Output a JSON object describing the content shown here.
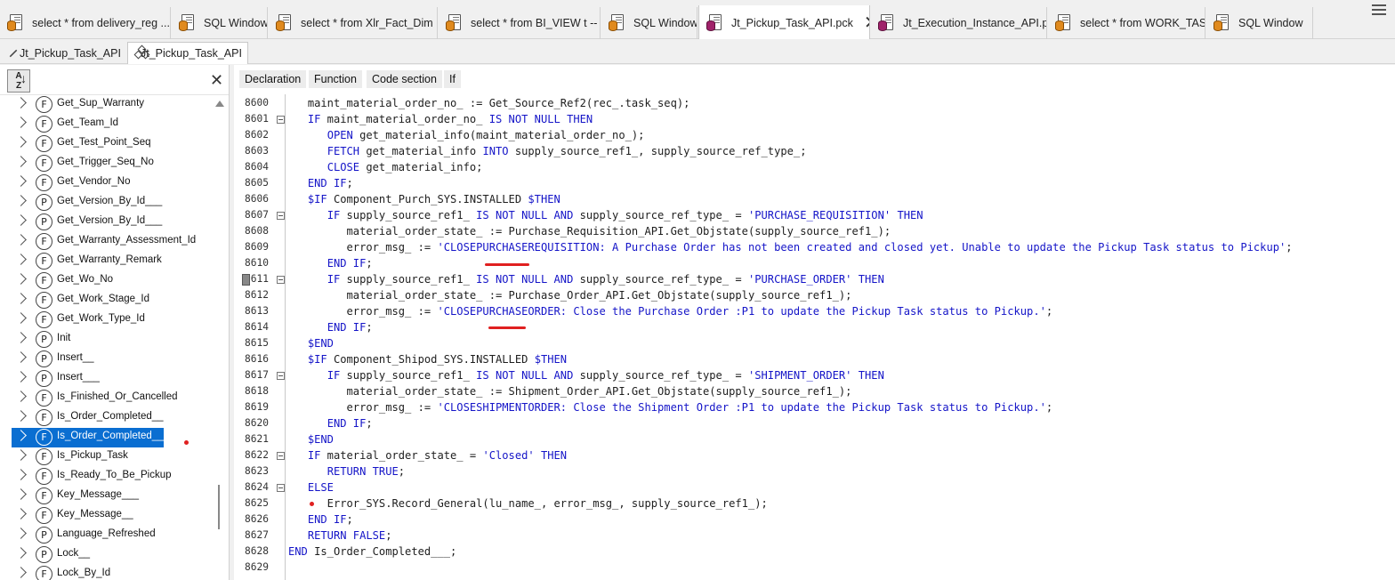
{
  "doc_tabs": [
    {
      "label": "select * from delivery_reg ...",
      "kind": "sql"
    },
    {
      "label": "SQL Window",
      "kind": "sql"
    },
    {
      "label": "select * from Xlr_Fact_Dim ...",
      "kind": "sql"
    },
    {
      "label": "select * from BI_VIEW t -- ...",
      "kind": "sql"
    },
    {
      "label": "SQL Window",
      "kind": "sql"
    },
    {
      "label": "Jt_Pickup_Task_API.pck",
      "kind": "pck",
      "active": true
    },
    {
      "label": "Jt_Execution_Instance_API.pck",
      "kind": "pck"
    },
    {
      "label": "select * from WORK_TASK",
      "kind": "sql"
    },
    {
      "label": "SQL Window",
      "kind": "sql"
    }
  ],
  "pkg_tabs": [
    {
      "label": "Jt_Pickup_Task_API",
      "icon": "package-spec-icon"
    },
    {
      "label": "Jt_Pickup_Task_API",
      "icon": "package-body-icon",
      "active": true
    }
  ],
  "navigator": {
    "sort_label": "A Z",
    "items": [
      {
        "kind": "F",
        "label": "Get_Sup_Warranty"
      },
      {
        "kind": "F",
        "label": "Get_Team_Id"
      },
      {
        "kind": "F",
        "label": "Get_Test_Point_Seq"
      },
      {
        "kind": "F",
        "label": "Get_Trigger_Seq_No"
      },
      {
        "kind": "F",
        "label": "Get_Vendor_No"
      },
      {
        "kind": "P",
        "label": "Get_Version_By_Id___"
      },
      {
        "kind": "P",
        "label": "Get_Version_By_Id___"
      },
      {
        "kind": "F",
        "label": "Get_Warranty_Assessment_Id"
      },
      {
        "kind": "F",
        "label": "Get_Warranty_Remark"
      },
      {
        "kind": "F",
        "label": "Get_Wo_No"
      },
      {
        "kind": "F",
        "label": "Get_Work_Stage_Id"
      },
      {
        "kind": "F",
        "label": "Get_Work_Type_Id"
      },
      {
        "kind": "P",
        "label": "Init"
      },
      {
        "kind": "P",
        "label": "Insert__"
      },
      {
        "kind": "P",
        "label": "Insert___"
      },
      {
        "kind": "F",
        "label": "Is_Finished_Or_Cancelled"
      },
      {
        "kind": "F",
        "label": "Is_Order_Completed__"
      },
      {
        "kind": "F",
        "label": "Is_Order_Completed___",
        "selected": true
      },
      {
        "kind": "F",
        "label": "Is_Pickup_Task"
      },
      {
        "kind": "F",
        "label": "Is_Ready_To_Be_Pickup"
      },
      {
        "kind": "F",
        "label": "Key_Message___"
      },
      {
        "kind": "F",
        "label": "Key_Message__"
      },
      {
        "kind": "P",
        "label": "Language_Refreshed"
      },
      {
        "kind": "P",
        "label": "Lock__"
      },
      {
        "kind": "F",
        "label": "Lock_By_Id"
      }
    ]
  },
  "editor_toolbar": [
    "Declaration",
    "Function",
    "Code section",
    "If"
  ],
  "code": [
    {
      "n": "8600",
      "tokens": [
        [
          "t",
          "   maint_material_order_no_ := Get_Source_Ref2(rec_.task_seq);"
        ]
      ]
    },
    {
      "n": "8601",
      "fold": true,
      "tokens": [
        [
          "t",
          "   "
        ],
        [
          "k",
          "IF"
        ],
        [
          "t",
          " maint_material_order_no_ "
        ],
        [
          "k",
          "IS NOT NULL THEN"
        ]
      ]
    },
    {
      "n": "8602",
      "tokens": [
        [
          "t",
          "      "
        ],
        [
          "k",
          "OPEN"
        ],
        [
          "t",
          " get_material_info(maint_material_order_no_);"
        ]
      ]
    },
    {
      "n": "8603",
      "tokens": [
        [
          "t",
          "      "
        ],
        [
          "k",
          "FETCH"
        ],
        [
          "t",
          " get_material_info "
        ],
        [
          "k",
          "INTO"
        ],
        [
          "t",
          " supply_source_ref1_, supply_source_ref_type_;"
        ]
      ]
    },
    {
      "n": "8604",
      "tokens": [
        [
          "t",
          "      "
        ],
        [
          "k",
          "CLOSE"
        ],
        [
          "t",
          " get_material_info;"
        ]
      ]
    },
    {
      "n": "8605",
      "tokens": [
        [
          "t",
          "   "
        ],
        [
          "k",
          "END IF"
        ],
        [
          "t",
          ";"
        ]
      ]
    },
    {
      "n": "8606",
      "tokens": [
        [
          "t",
          "   "
        ],
        [
          "k",
          "$IF"
        ],
        [
          "t",
          " Component_Purch_SYS.INSTALLED "
        ],
        [
          "k",
          "$THEN"
        ]
      ]
    },
    {
      "n": "8607",
      "fold": true,
      "tokens": [
        [
          "t",
          "      "
        ],
        [
          "k",
          "IF"
        ],
        [
          "t",
          " supply_source_ref1_ "
        ],
        [
          "k",
          "IS NOT NULL AND"
        ],
        [
          "t",
          " supply_source_ref_type_ = "
        ],
        [
          "s",
          "'PURCHASE_REQUISITION'"
        ],
        [
          "t",
          " "
        ],
        [
          "k",
          "THEN"
        ]
      ]
    },
    {
      "n": "8608",
      "tokens": [
        [
          "t",
          "         material_order_state_ := Purchase_Requisition_API.Get_Objstate(supply_source_ref1_);"
        ]
      ]
    },
    {
      "n": "8609",
      "tokens": [
        [
          "t",
          "         error_msg_ := "
        ],
        [
          "s",
          "'CLOSEPURCHASEREQUISITION: A Purchase Order has not been created and closed yet. Unable to update the Pickup Task status to Pickup'"
        ],
        [
          "t",
          ";"
        ]
      ]
    },
    {
      "n": "8610",
      "tokens": [
        [
          "t",
          "      "
        ],
        [
          "k",
          "END IF"
        ],
        [
          "t",
          ";"
        ]
      ]
    },
    {
      "n": "8611",
      "fold": true,
      "bookmark": true,
      "tokens": [
        [
          "t",
          "      "
        ],
        [
          "k",
          "IF"
        ],
        [
          "t",
          " supply_source_ref1_ "
        ],
        [
          "k",
          "IS NOT NULL AND"
        ],
        [
          "t",
          " supply_source_ref_type_ = "
        ],
        [
          "s",
          "'PURCHASE_ORDER'"
        ],
        [
          "t",
          " "
        ],
        [
          "k",
          "THEN"
        ]
      ]
    },
    {
      "n": "8612",
      "tokens": [
        [
          "t",
          "         material_order_state_ := Purchase_Order_API.Get_Objstate(supply_source_ref1_);"
        ]
      ]
    },
    {
      "n": "8613",
      "tokens": [
        [
          "t",
          "         error_msg_ := "
        ],
        [
          "s",
          "'CLOSEPURCHASEORDER: Close the Purchase Order :P1 to update the Pickup Task status to Pickup.'"
        ],
        [
          "t",
          ";"
        ]
      ]
    },
    {
      "n": "8614",
      "tokens": [
        [
          "t",
          "      "
        ],
        [
          "k",
          "END IF"
        ],
        [
          "t",
          ";"
        ]
      ]
    },
    {
      "n": "8615",
      "tokens": [
        [
          "t",
          "   "
        ],
        [
          "k",
          "$END"
        ]
      ]
    },
    {
      "n": "8616",
      "tokens": [
        [
          "t",
          "   "
        ],
        [
          "k",
          "$IF"
        ],
        [
          "t",
          " Component_Shipod_SYS.INSTALLED "
        ],
        [
          "k",
          "$THEN"
        ]
      ]
    },
    {
      "n": "8617",
      "fold": true,
      "tokens": [
        [
          "t",
          "      "
        ],
        [
          "k",
          "IF"
        ],
        [
          "t",
          " supply_source_ref1_ "
        ],
        [
          "k",
          "IS NOT NULL AND"
        ],
        [
          "t",
          " supply_source_ref_type_ = "
        ],
        [
          "s",
          "'SHIPMENT_ORDER'"
        ],
        [
          "t",
          " "
        ],
        [
          "k",
          "THEN"
        ]
      ]
    },
    {
      "n": "8618",
      "tokens": [
        [
          "t",
          "         material_order_state_ := Shipment_Order_API.Get_Objstate(supply_source_ref1_);"
        ]
      ]
    },
    {
      "n": "8619",
      "tokens": [
        [
          "t",
          "         error_msg_ := "
        ],
        [
          "s",
          "'CLOSESHIPMENTORDER: Close the Shipment Order :P1 to update the Pickup Task status to Pickup.'"
        ],
        [
          "t",
          ";"
        ]
      ]
    },
    {
      "n": "8620",
      "tokens": [
        [
          "t",
          "      "
        ],
        [
          "k",
          "END IF"
        ],
        [
          "t",
          ";"
        ]
      ]
    },
    {
      "n": "8621",
      "tokens": [
        [
          "t",
          "   "
        ],
        [
          "k",
          "$END"
        ]
      ]
    },
    {
      "n": "8622",
      "fold": true,
      "tokens": [
        [
          "t",
          "   "
        ],
        [
          "k",
          "IF"
        ],
        [
          "t",
          " material_order_state_ = "
        ],
        [
          "s",
          "'Closed'"
        ],
        [
          "t",
          " "
        ],
        [
          "k",
          "THEN"
        ]
      ]
    },
    {
      "n": "8623",
      "tokens": [
        [
          "t",
          "      "
        ],
        [
          "k",
          "RETURN TRUE"
        ],
        [
          "t",
          ";"
        ]
      ]
    },
    {
      "n": "8624",
      "fold": true,
      "tokens": [
        [
          "t",
          "   "
        ],
        [
          "k",
          "ELSE"
        ]
      ]
    },
    {
      "n": "8625",
      "tokens": [
        [
          "t",
          "      Error_SYS.Record_General(lu_name_, error_msg_, supply_source_ref1_);"
        ]
      ]
    },
    {
      "n": "8626",
      "tokens": [
        [
          "t",
          "   "
        ],
        [
          "k",
          "END IF"
        ],
        [
          "t",
          ";"
        ]
      ]
    },
    {
      "n": "8627",
      "tokens": [
        [
          "t",
          "   "
        ],
        [
          "k",
          "RETURN FALSE"
        ],
        [
          "t",
          ";"
        ]
      ]
    },
    {
      "n": "8628",
      "tokens": [
        [
          "k",
          "END"
        ],
        [
          "t",
          " Is_Order_Completed___;"
        ]
      ]
    },
    {
      "n": "8629",
      "tokens": []
    }
  ],
  "colors": {
    "keyword": "#1515c8",
    "selection": "#0a6ed1",
    "annotation": "#e02020"
  }
}
